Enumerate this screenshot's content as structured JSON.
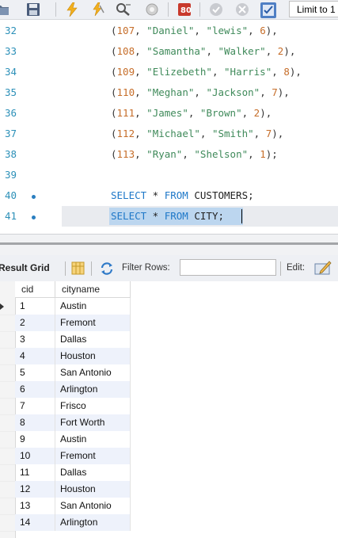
{
  "toolbar": {
    "icons": [
      "open-folder-icon",
      "save-icon",
      "execute-icon",
      "execute-current-icon",
      "find-icon",
      "stop-icon",
      "toggle-error-icon",
      "commit-icon",
      "rollback-icon",
      "autocommit-icon"
    ],
    "limit_label": "Limit to 1"
  },
  "editor": {
    "lines": [
      {
        "num": "32",
        "parts": [
          [
            "p",
            "("
          ],
          [
            "n",
            "107"
          ],
          [
            "p",
            ", "
          ],
          [
            "s",
            "\"Daniel\""
          ],
          [
            "p",
            ", "
          ],
          [
            "s",
            "\"lewis\""
          ],
          [
            "p",
            ", "
          ],
          [
            "n",
            "6"
          ],
          [
            "p",
            "),"
          ]
        ]
      },
      {
        "num": "33",
        "parts": [
          [
            "p",
            "("
          ],
          [
            "n",
            "108"
          ],
          [
            "p",
            ", "
          ],
          [
            "s",
            "\"Samantha\""
          ],
          [
            "p",
            ", "
          ],
          [
            "s",
            "\"Walker\""
          ],
          [
            "p",
            ", "
          ],
          [
            "n",
            "2"
          ],
          [
            "p",
            "),"
          ]
        ]
      },
      {
        "num": "34",
        "parts": [
          [
            "p",
            "("
          ],
          [
            "n",
            "109"
          ],
          [
            "p",
            ", "
          ],
          [
            "s",
            "\"Elizebeth\""
          ],
          [
            "p",
            ", "
          ],
          [
            "s",
            "\"Harris\""
          ],
          [
            "p",
            ", "
          ],
          [
            "n",
            "8"
          ],
          [
            "p",
            "),"
          ]
        ]
      },
      {
        "num": "35",
        "parts": [
          [
            "p",
            "("
          ],
          [
            "n",
            "110"
          ],
          [
            "p",
            ", "
          ],
          [
            "s",
            "\"Meghan\""
          ],
          [
            "p",
            ", "
          ],
          [
            "s",
            "\"Jackson\""
          ],
          [
            "p",
            ", "
          ],
          [
            "n",
            "7"
          ],
          [
            "p",
            "),"
          ]
        ]
      },
      {
        "num": "36",
        "parts": [
          [
            "p",
            "("
          ],
          [
            "n",
            "111"
          ],
          [
            "p",
            ", "
          ],
          [
            "s",
            "\"James\""
          ],
          [
            "p",
            ", "
          ],
          [
            "s",
            "\"Brown\""
          ],
          [
            "p",
            ", "
          ],
          [
            "n",
            "2"
          ],
          [
            "p",
            "),"
          ]
        ]
      },
      {
        "num": "37",
        "parts": [
          [
            "p",
            "("
          ],
          [
            "n",
            "112"
          ],
          [
            "p",
            ", "
          ],
          [
            "s",
            "\"Michael\""
          ],
          [
            "p",
            ", "
          ],
          [
            "s",
            "\"Smith\""
          ],
          [
            "p",
            ", "
          ],
          [
            "n",
            "7"
          ],
          [
            "p",
            "),"
          ]
        ]
      },
      {
        "num": "38",
        "parts": [
          [
            "p",
            "("
          ],
          [
            "n",
            "113"
          ],
          [
            "p",
            ", "
          ],
          [
            "s",
            "\"Ryan\""
          ],
          [
            "p",
            ", "
          ],
          [
            "s",
            "\"Shelson\""
          ],
          [
            "p",
            ", "
          ],
          [
            "n",
            "1"
          ],
          [
            "p",
            ");"
          ]
        ]
      },
      {
        "num": "39",
        "parts": []
      },
      {
        "num": "40",
        "marker": true,
        "parts": [
          [
            "k",
            "SELECT"
          ],
          [
            "t",
            " * "
          ],
          [
            "k",
            "FROM"
          ],
          [
            "t",
            " CUSTOMERS;"
          ]
        ]
      },
      {
        "num": "41",
        "marker": true,
        "active": true,
        "parts": [
          [
            "k",
            "SELECT"
          ],
          [
            "t",
            " * "
          ],
          [
            "k",
            "FROM"
          ],
          [
            "t",
            " CITY;"
          ]
        ]
      }
    ]
  },
  "result": {
    "tab_label": "Result Grid",
    "filter_label": "Filter Rows:",
    "filter_value": "",
    "edit_label": "Edit:",
    "columns": [
      "cid",
      "cityname"
    ],
    "rows": [
      [
        "1",
        "Austin"
      ],
      [
        "2",
        "Fremont"
      ],
      [
        "3",
        "Dallas"
      ],
      [
        "4",
        "Houston"
      ],
      [
        "5",
        "San Antonio"
      ],
      [
        "6",
        "Arlington"
      ],
      [
        "7",
        "Frisco"
      ],
      [
        "8",
        "Fort Worth"
      ],
      [
        "9",
        "Austin"
      ],
      [
        "10",
        "Fremont"
      ],
      [
        "11",
        "Dallas"
      ],
      [
        "12",
        "Houston"
      ],
      [
        "13",
        "San Antonio"
      ],
      [
        "14",
        "Arlington"
      ]
    ]
  },
  "colors": {
    "line_numbers": "#2c90b8",
    "keyword": "#1f78c8",
    "number": "#c66e2a",
    "string": "#3f8a5a",
    "selection": "#bcd6ef",
    "row_alt": "#eef2fb"
  }
}
